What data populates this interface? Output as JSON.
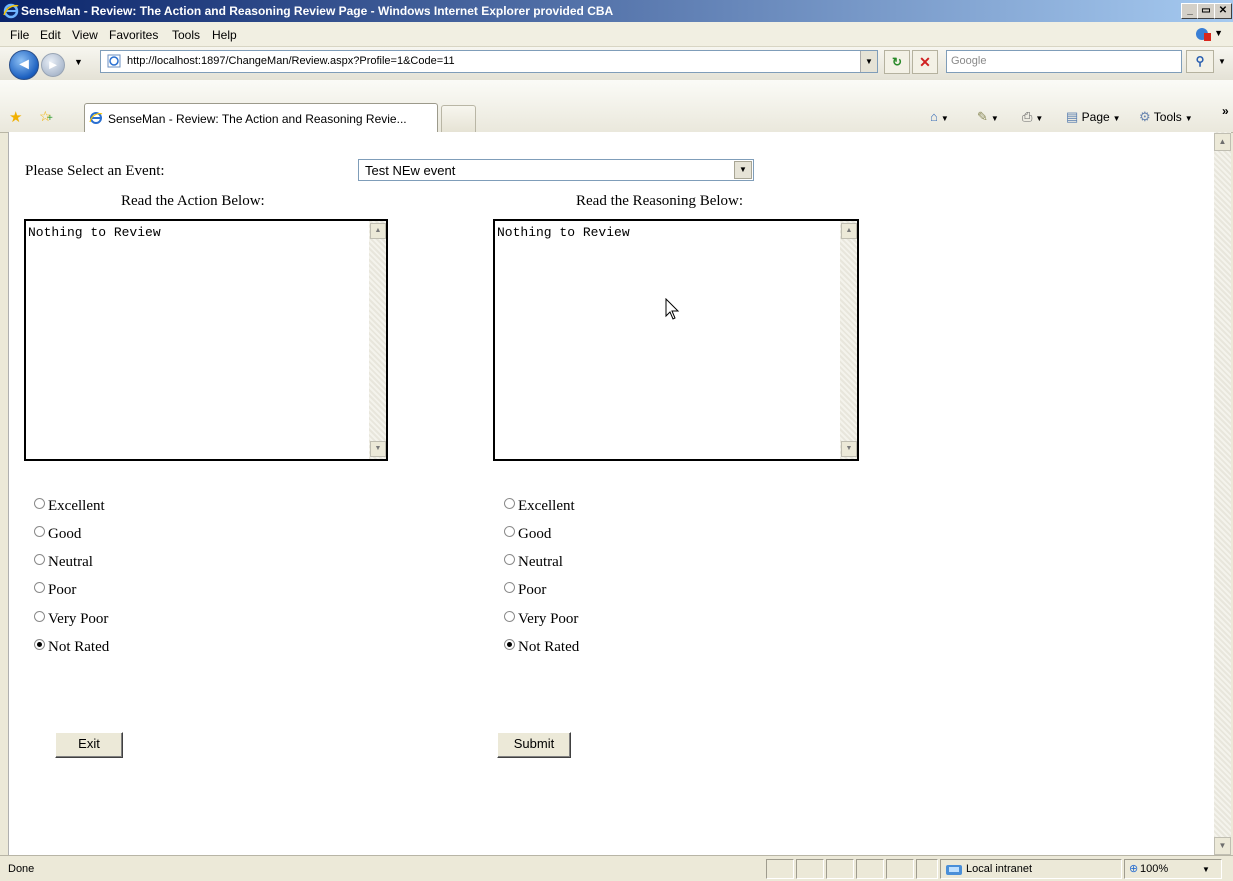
{
  "window": {
    "title": "SenseMan - Review: The Action and Reasoning Review Page - Windows Internet Explorer provided CBA",
    "min_label": "_",
    "max_label": "▭",
    "close_label": "✕"
  },
  "menu": {
    "items": [
      "File",
      "Edit",
      "View",
      "Favorites",
      "Tools",
      "Help"
    ]
  },
  "address": {
    "url": "http://localhost:1897/ChangeMan/Review.aspx?Profile=1&Code=11",
    "search_placeholder": "Google"
  },
  "tab": {
    "label": "SenseMan - Review: The Action and Reasoning Revie...",
    "commands": {
      "page": "Page",
      "tools": "Tools",
      "more": "»"
    }
  },
  "form": {
    "event_label": "Please Select an Event:",
    "event_selected": "Test NEw event",
    "action_heading": "Read the Action Below:",
    "reasoning_heading": "Read the Reasoning Below:",
    "action_text": "Nothing to Review",
    "reasoning_text": "Nothing to Review",
    "rating_options": [
      "Excellent",
      "Good",
      "Neutral",
      "Poor",
      "Very Poor",
      "Not Rated"
    ],
    "action_selected": "Not Rated",
    "reasoning_selected": "Not Rated",
    "exit_label": "Exit",
    "submit_label": "Submit"
  },
  "status": {
    "text": "Done",
    "zone": "Local intranet",
    "zoom": "100%"
  },
  "colors": {
    "title_bar_start": "#0a246a",
    "title_bar_end": "#a6caf0",
    "chrome": "#ece9d8"
  }
}
